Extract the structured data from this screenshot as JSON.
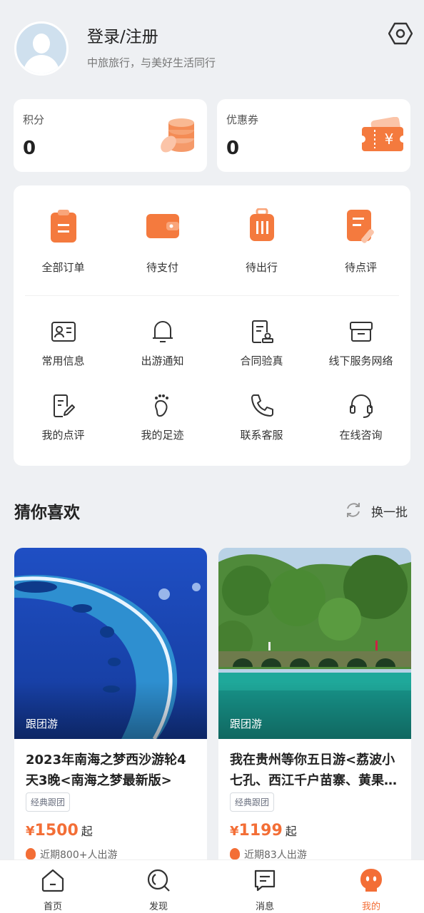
{
  "header": {
    "login_label": "登录/注册",
    "slogan": "中旅旅行，与美好生活同行"
  },
  "points": {
    "label": "积分",
    "value": "0"
  },
  "coupons": {
    "label": "优惠券",
    "value": "0"
  },
  "orders": [
    {
      "label": "全部订单",
      "icon": "clipboard-icon"
    },
    {
      "label": "待支付",
      "icon": "wallet-icon"
    },
    {
      "label": "待出行",
      "icon": "suitcase-icon"
    },
    {
      "label": "待点评",
      "icon": "review-pen-icon"
    }
  ],
  "services": [
    {
      "label": "常用信息",
      "icon": "id-card-icon"
    },
    {
      "label": "出游通知",
      "icon": "bell-icon"
    },
    {
      "label": "合同验真",
      "icon": "contract-icon"
    },
    {
      "label": "线下服务网络",
      "icon": "store-icon"
    },
    {
      "label": "我的点评",
      "icon": "edit-doc-icon"
    },
    {
      "label": "我的足迹",
      "icon": "footprint-icon"
    },
    {
      "label": "联系客服",
      "icon": "phone-icon"
    },
    {
      "label": "在线咨询",
      "icon": "headset-icon"
    }
  ],
  "recommend": {
    "title": "猜你喜欢",
    "refresh_label": "换一批"
  },
  "products": [
    {
      "tag": "跟团游",
      "title": "2023年南海之梦西沙游轮4天3晚<南海之梦最新版>",
      "badge": "经典跟团",
      "currency": "¥",
      "price": "1500",
      "suffix": "起",
      "sold": "近期800+人出游"
    },
    {
      "tag": "跟团游",
      "title": "我在贵州等你五日游<荔波小七孔、西江千户苗寨、黄果…",
      "badge": "经典跟团",
      "currency": "¥",
      "price": "1199",
      "suffix": "起",
      "sold": "近期83人出游"
    }
  ],
  "tabbar": [
    {
      "label": "首页",
      "icon": "home-icon"
    },
    {
      "label": "发现",
      "icon": "discover-icon"
    },
    {
      "label": "消息",
      "icon": "message-icon"
    },
    {
      "label": "我的",
      "icon": "profile-icon"
    }
  ],
  "colors": {
    "accent": "#f36e36",
    "background": "#eef0f3"
  }
}
